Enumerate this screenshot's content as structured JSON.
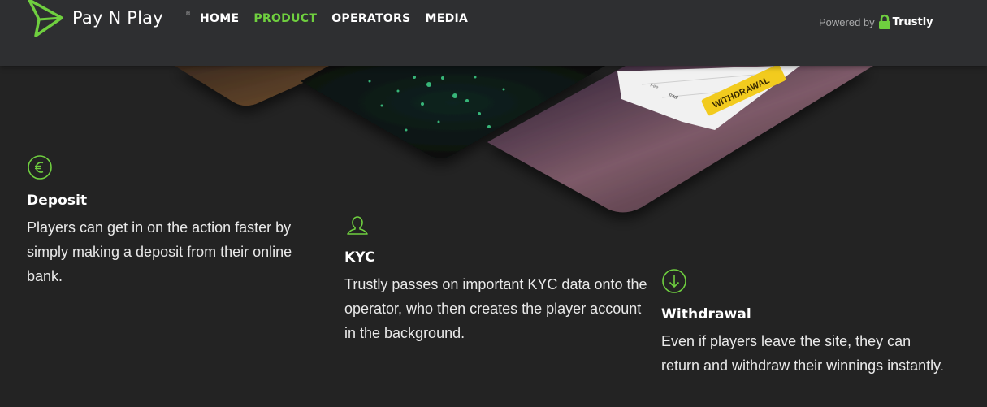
{
  "header": {
    "brand": "Pay N Play",
    "brand_mark": "®",
    "nav": [
      {
        "label": "HOME",
        "active": false
      },
      {
        "label": "PRODUCT",
        "active": true
      },
      {
        "label": "OPERATORS",
        "active": false
      },
      {
        "label": "MEDIA",
        "active": false
      }
    ],
    "powered_label": "Powered by",
    "powered_brand": "Trustly"
  },
  "hero_card": {
    "fee_label": "Fee",
    "total_label": "Total",
    "withdraw_button": "WITHDRAWAL"
  },
  "features": [
    {
      "icon": "euro-icon",
      "title": "Deposit",
      "text": "Players can get in on the action faster by simply making a deposit from their online bank."
    },
    {
      "icon": "user-icon",
      "title": "KYC",
      "text": "Trustly passes on important KYC data onto the operator, who then creates the player account in the background."
    },
    {
      "icon": "arrow-down-icon",
      "title": "Withdrawal",
      "text": "Even if players leave the site, they can return and withdraw their winnings instantly."
    }
  ],
  "colors": {
    "accent": "#6fcf3f",
    "header_bg": "#2e2f31",
    "page_bg": "#232323"
  }
}
